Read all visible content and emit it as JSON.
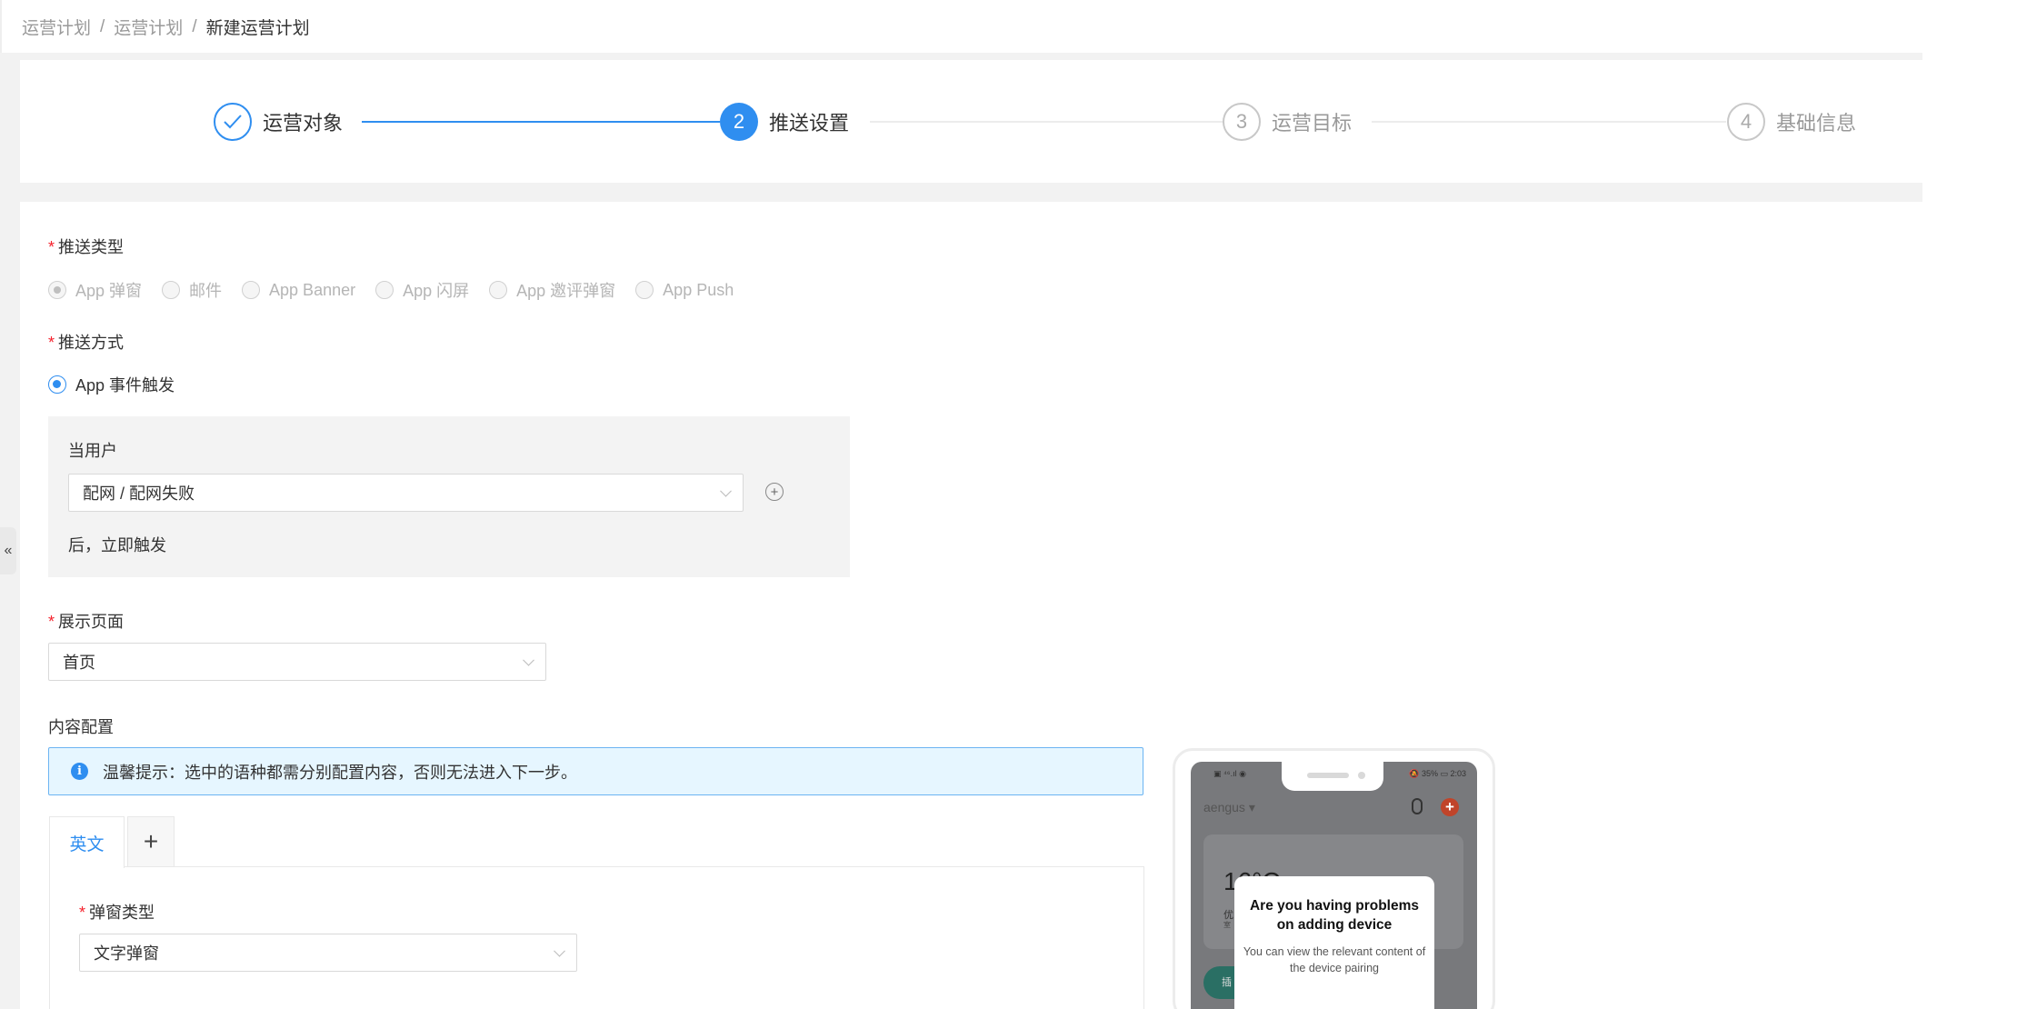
{
  "breadcrumb": {
    "items": [
      "运营计划",
      "运营计划",
      "新建运营计划"
    ],
    "separator": "/"
  },
  "steps": [
    {
      "number": "1",
      "label": "运营对象",
      "status": "done"
    },
    {
      "number": "2",
      "label": "推送设置",
      "status": "active"
    },
    {
      "number": "3",
      "label": "运营目标",
      "status": "todo"
    },
    {
      "number": "4",
      "label": "基础信息",
      "status": "todo"
    }
  ],
  "form": {
    "required_mark": "*",
    "push_type": {
      "label": "推送类型",
      "options": [
        "App 弹窗",
        "邮件",
        "App Banner",
        "App 闪屏",
        "App 邀评弹窗",
        "App Push"
      ],
      "selected": "App 弹窗",
      "disabled": true
    },
    "push_method": {
      "label": "推送方式",
      "options": [
        "App 事件触发"
      ],
      "selected": "App 事件触发"
    },
    "trigger": {
      "prefix": "当用户",
      "event_value": "配网 / 配网失败",
      "suffix": "后，立即触发"
    },
    "display_page": {
      "label": "展示页面",
      "value": "首页"
    },
    "content_config": {
      "label": "内容配置",
      "alert": "温馨提示：选中的语种都需分别配置内容，否则无法进入下一步。",
      "tabs": [
        "英文"
      ],
      "add_tab_label": "+",
      "popup_type": {
        "label": "弹窗类型",
        "value": "文字弹窗"
      }
    }
  },
  "preview": {
    "status_left": "▣ ⁴⁶.ıl ◉",
    "status_right": "🔕 35% ▭ 2:03",
    "home_name": "aengus ▾",
    "temperature": "16°C",
    "weather_line1": "优",
    "weather_line2": "室",
    "button_text": "插",
    "dialog_title": "Are you having problems on adding device",
    "dialog_body": "You can view the relevant content of the device pairing"
  },
  "sidebar_toggle": "«",
  "colors": {
    "primary": "#2f8ef0",
    "required": "#f5222d",
    "alert_bg": "#e6f6ff",
    "page_bg": "#f2f2f2"
  }
}
